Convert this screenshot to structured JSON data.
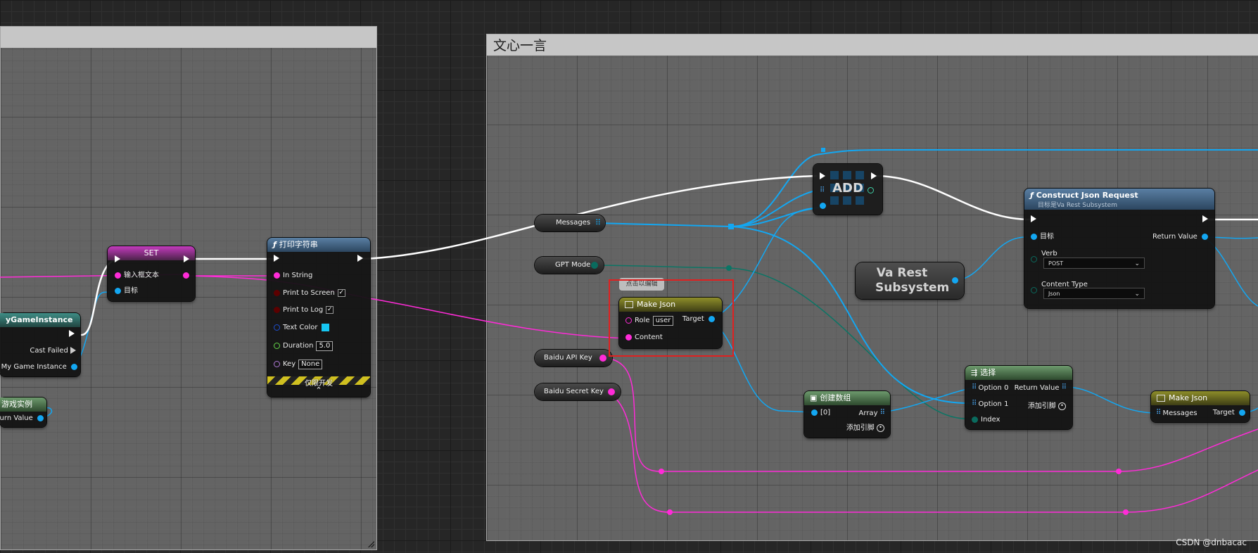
{
  "graph": {
    "right_comment_title": "文心一言",
    "watermark": "CSDN @dnbacac",
    "colors": {
      "exec": "#ffffff",
      "string": "#ff2bd8",
      "object": "#13a7f2",
      "enum": "#0a6b5e",
      "bool": "#8a0000"
    }
  },
  "nodes": {
    "cast": {
      "title": "yGameInstance",
      "cast_failed": "Cast Failed",
      "as_label": "s My Game Instance"
    },
    "getinst": {
      "title": "游戏实例",
      "return_label": "urn Value"
    },
    "set": {
      "title": "SET",
      "pin_text": "输入框文本",
      "pin_target": "目标"
    },
    "print": {
      "title": "打印字符串",
      "in_string": "In String",
      "print_screen": "Print to Screen",
      "print_log": "Print to Log",
      "text_color": "Text Color",
      "duration": "Duration",
      "duration_val": "5.0",
      "key": "Key",
      "key_val": "None",
      "dev_only": "仅限开发",
      "check_mark": "✓"
    },
    "messages": {
      "label": "Messages"
    },
    "gptmode": {
      "label": "GPT Mode"
    },
    "api_key": {
      "label": "Baidu API Key"
    },
    "secret_key": {
      "label": "Baidu Secret Key"
    },
    "add": {
      "title": "ADD"
    },
    "makejson": {
      "title": "Make Json",
      "tooltip": "点击以编辑",
      "role": "Role",
      "role_val": "user",
      "content": "Content",
      "target": "Target"
    },
    "construct": {
      "title": "Construct Json Request",
      "subtitle": "目标是Va Rest Subsystem",
      "target": "目标",
      "return_val": "Return Value",
      "verb": "Verb",
      "verb_val": "POST",
      "ctype": "Content Type",
      "ctype_val": "Json"
    },
    "varest": {
      "title": "Va Rest Subsystem"
    },
    "makearray": {
      "title": "创建数组",
      "elem": "[0]",
      "array": "Array",
      "add_pin": "添加引脚"
    },
    "select": {
      "title": "选择",
      "opt0": "Option 0",
      "opt1": "Option 1",
      "index": "Index",
      "ret": "Return Value",
      "add_pin": "添加引脚"
    },
    "makejson2": {
      "title": "Make Json",
      "messages": "Messages",
      "target": "Target"
    }
  }
}
